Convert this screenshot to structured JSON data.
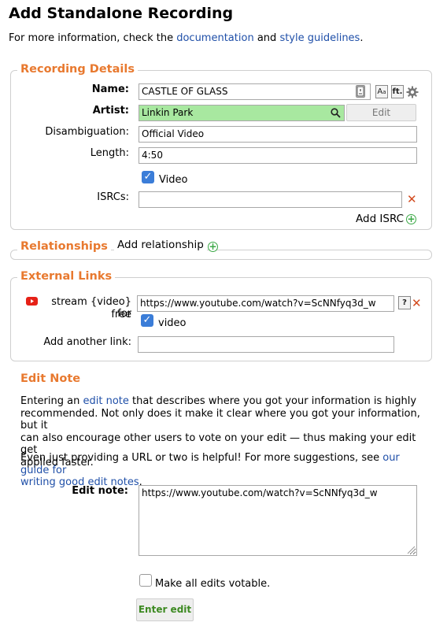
{
  "page": {
    "title": "Add Standalone Recording",
    "intro_prefix": "For more information, check the",
    "intro_doc_link": "documentation",
    "intro_and": "and",
    "intro_style_link": "style guidelines",
    "intro_end": "."
  },
  "recording_details": {
    "legend": "Recording Details",
    "name_label": "Name:",
    "name_value": "CASTLE OF GLASS",
    "artist_label": "Artist:",
    "artist_value": "Linkin Park",
    "edit_button": "Edit",
    "disambiguation_label": "Disambiguation:",
    "disambiguation_value": "Official Video",
    "length_label": "Length:",
    "length_value": "4:50",
    "video_label": "Video",
    "video_checked": true,
    "isrcs_label": "ISRCs:",
    "isrc_value": "",
    "add_isrc_label": "Add ISRC",
    "case_button_text": "A",
    "ft_button_text": "ft."
  },
  "relationships": {
    "legend": "Relationships",
    "add_label": "Add relationship"
  },
  "external_links": {
    "legend": "External Links",
    "link_type_line1": "stream {video} for",
    "link_type_line2": "free",
    "link_url": "https://www.youtube.com/watch?v=ScNNfyq3d_w",
    "help_button": "?",
    "video_label": "video",
    "add_link_label": "Add another link:",
    "add_link_value": ""
  },
  "edit_note": {
    "heading": "Edit Note",
    "para1_a": "Entering an",
    "para1_link": "edit note",
    "para1_b": "that describes where you got your information is highly",
    "para1_line2": "recommended. Not only does it make it clear where you got your information, but it",
    "para1_line3": "can also encourage other users to vote on your edit — thus making your edit get",
    "para1_line4": "applied faster.",
    "para2_a": "Even just providing a URL or two is helpful! For more suggestions, see",
    "para2_link_1": "our guide for",
    "para2_link_2": "writing good edit notes",
    "para2_end": ".",
    "label": "Edit note:",
    "value": "https://www.youtube.com/watch?v=ScNNfyq3d_w",
    "votable_label": "Make all edits votable.",
    "submit_button": "Enter edit"
  },
  "colors": {
    "legend": "#e8792f",
    "link": "#1f4fa8",
    "artist_bg": "#a8e8a0",
    "remove": "#d24a1e",
    "add": "#3aa845",
    "checkbox": "#3b7dd8",
    "youtube": "#e62117"
  },
  "icons": [
    "search-icon",
    "gear-icon",
    "youtube-icon",
    "remove-icon",
    "add-icon",
    "checkmark-icon",
    "resize-grip-icon",
    "lock-icon"
  ]
}
